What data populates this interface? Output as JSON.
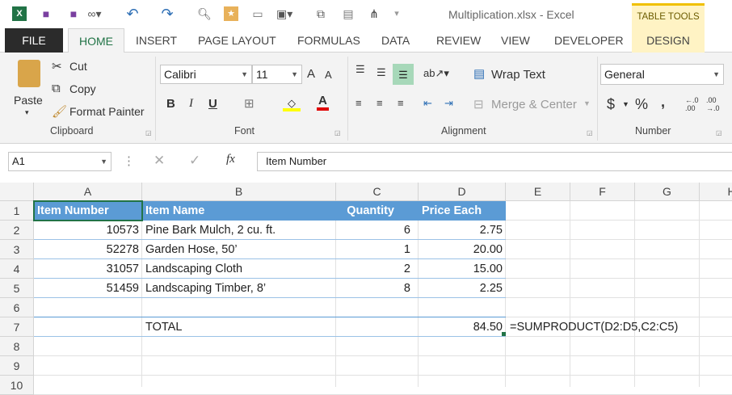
{
  "window": {
    "title": "Multiplication.xlsx - Excel",
    "context_tab_group": "TABLE TOOLS"
  },
  "tabs": [
    "FILE",
    "HOME",
    "INSERT",
    "PAGE LAYOUT",
    "FORMULAS",
    "DATA",
    "REVIEW",
    "VIEW",
    "DEVELOPER",
    "DESIGN"
  ],
  "clipboard": {
    "paste": "Paste",
    "cut": "Cut",
    "copy": "Copy",
    "format_painter": "Format Painter",
    "group": "Clipboard"
  },
  "font": {
    "name": "Calibri",
    "size": "11",
    "group": "Font",
    "bold": "B",
    "italic": "I",
    "underline": "U",
    "grow": "A",
    "shrink": "A",
    "color_letter": "A"
  },
  "alignment": {
    "wrap": "Wrap Text",
    "merge": "Merge & Center",
    "group": "Alignment"
  },
  "number": {
    "format": "General",
    "currency": "$",
    "percent": "%",
    "comma": ",",
    "group": "Number"
  },
  "formula_bar": {
    "name_box": "A1",
    "fx": "fx",
    "value": "Item Number"
  },
  "columns": [
    "A",
    "B",
    "C",
    "D",
    "E",
    "F",
    "G",
    "H"
  ],
  "rows": [
    "1",
    "2",
    "3",
    "4",
    "5",
    "6",
    "7",
    "8",
    "9",
    "10"
  ],
  "table": {
    "headers": [
      "Item Number",
      "Item Name",
      "Quantity",
      "Price Each"
    ],
    "data": [
      [
        "10573",
        "Pine Bark Mulch, 2 cu. ft.",
        "6",
        "2.75"
      ],
      [
        "52278",
        "Garden Hose, 50’",
        "1",
        "20.00"
      ],
      [
        "31057",
        "Landscaping Cloth",
        "2",
        "15.00"
      ],
      [
        "51459",
        "Landscaping Timber, 8’",
        "8",
        "2.25"
      ]
    ],
    "total_label": "TOTAL",
    "total_value": "84.50"
  },
  "annotation": "=SUMPRODUCT(D2:D5,C2:C5)",
  "colors": {
    "header_blue": "#5b9bd5",
    "excel_green": "#217346"
  }
}
